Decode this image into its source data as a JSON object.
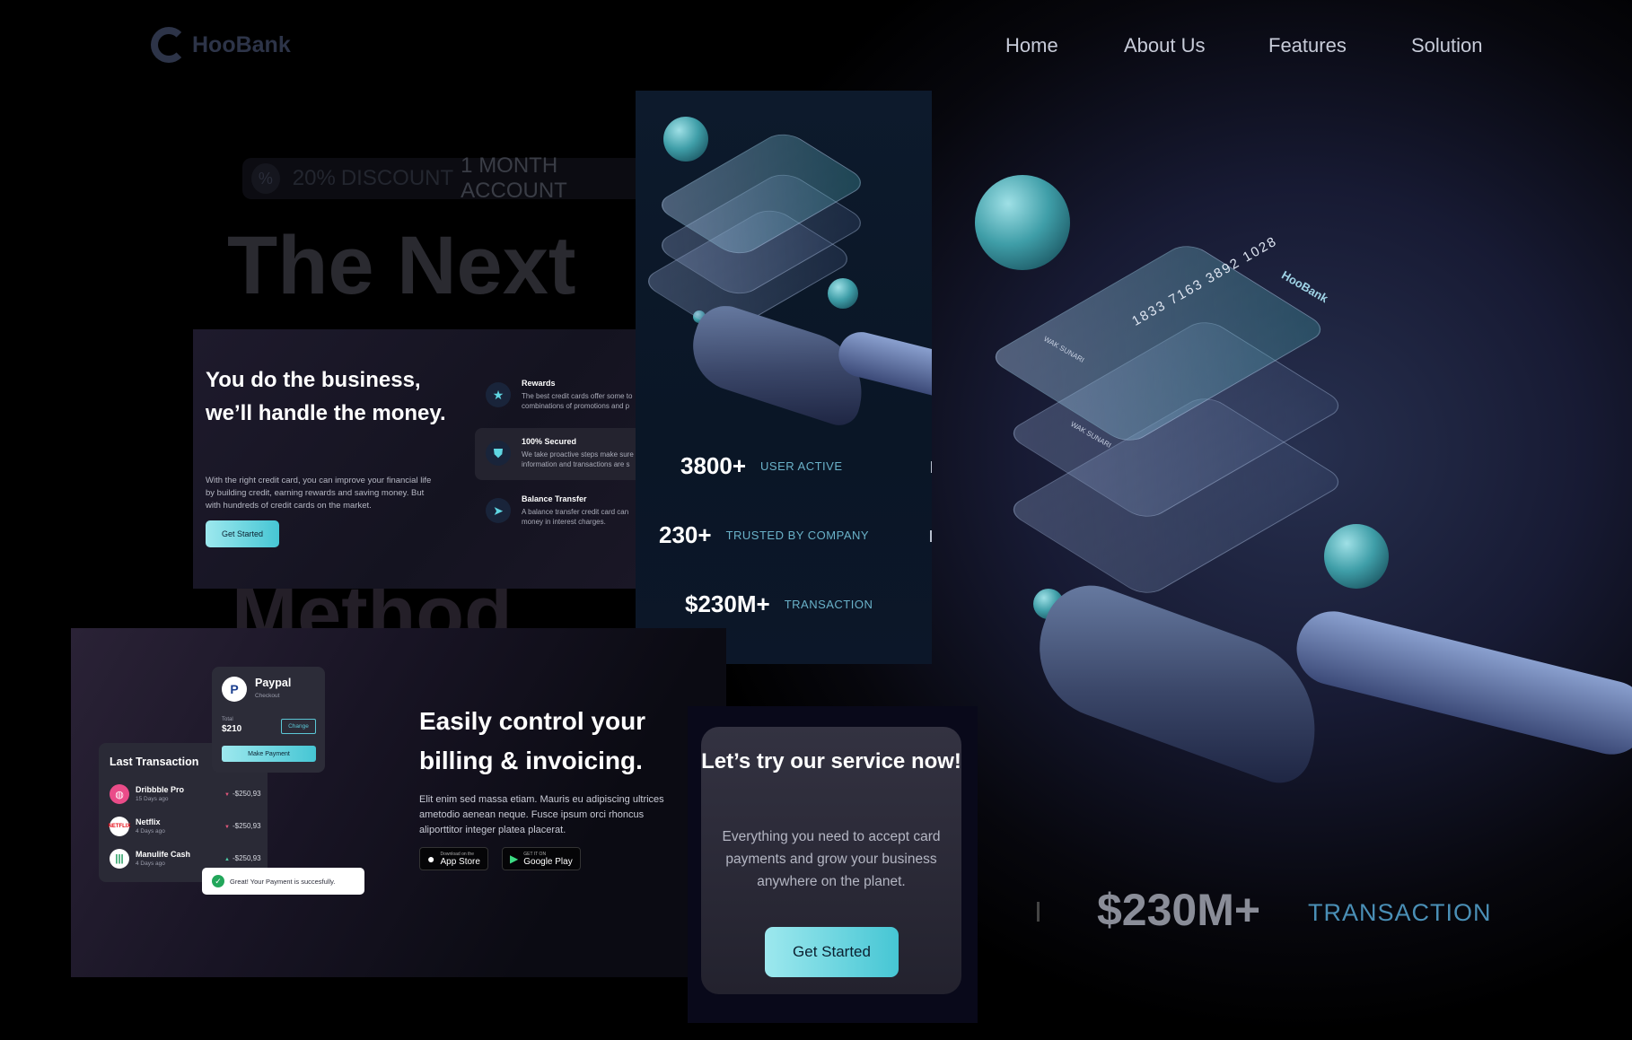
{
  "brand": {
    "name": "HooBank"
  },
  "nav": {
    "items": [
      "Home",
      "About Us",
      "Features",
      "Solution"
    ]
  },
  "hero": {
    "discount_percent": "20%",
    "discount_word": "DISCOUNT",
    "discount_rest": "1 MONTH ACCOUNT",
    "title_line1": "The Next",
    "title_line3": "Method",
    "bottom_stat_value": "$230M+",
    "bottom_stat_label": "TRANSACTION"
  },
  "card_art": {
    "card_number": "1833 7163 3892 1028",
    "holder_front": "WAK SUNARI",
    "holder_back": "WAK SUNARI"
  },
  "business": {
    "title": "You do the business, we’ll handle the money.",
    "body": "With the right credit card, you can improve your financial life by building credit, earning rewards and saving money. But with hundreds of credit cards on the market.",
    "cta": "Get Started",
    "features": [
      {
        "icon": "star-icon",
        "title": "Rewards",
        "desc1": "The best credit cards offer some to",
        "desc2": "combinations of promotions and p"
      },
      {
        "icon": "shield-icon",
        "title": "100% Secured",
        "desc1": "We take proactive steps make sure",
        "desc2": "information and transactions are s"
      },
      {
        "icon": "send-icon",
        "title": "Balance Transfer",
        "desc1": "A balance transfer credit card can",
        "desc2": "money in interest charges."
      }
    ]
  },
  "stats": [
    {
      "value": "3800+",
      "label": "USER ACTIVE"
    },
    {
      "value": "230+",
      "label": "TRUSTED BY COMPANY"
    },
    {
      "value": "$230M+",
      "label": "TRANSACTION"
    }
  ],
  "billing": {
    "title": "Easily control your billing & invoicing.",
    "body": "Elit enim sed massa etiam. Mauris eu adipiscing ultrices ametodio aenean neque. Fusce ipsum orci rhoncus aliporttitor integer platea placerat.",
    "app_store_small": "Download on the",
    "app_store": "App Store",
    "google_play_small": "GET IT ON",
    "google_play": "Google Play"
  },
  "transactions": {
    "title": "Last Transaction",
    "items": [
      {
        "name": "Dribbble Pro",
        "time": "15 Days ago",
        "amount": "-$250,93",
        "dir": "down"
      },
      {
        "name": "Netflix",
        "time": "4 Days ago",
        "amount": "-$250,93",
        "dir": "down"
      },
      {
        "name": "Manulife Cash",
        "time": "4 Days ago",
        "amount": "-$250,93",
        "dir": "up"
      }
    ]
  },
  "paypal": {
    "name": "Paypal",
    "sub": "Checkout",
    "total_label": "Total",
    "total": "$210",
    "change": "Change",
    "make_payment": "Make Payment"
  },
  "toast": {
    "text": "Great! Your Payment is succesfully."
  },
  "cta": {
    "title": "Let’s try our service now!",
    "body": "Everything you need to accept card payments and grow your business anywhere on the planet.",
    "button": "Get Started"
  },
  "colors": {
    "accent": "#46c6d4",
    "accent_light": "#9de8ee",
    "stat_label": "#6ab2c9",
    "bg_dark": "#000000"
  }
}
